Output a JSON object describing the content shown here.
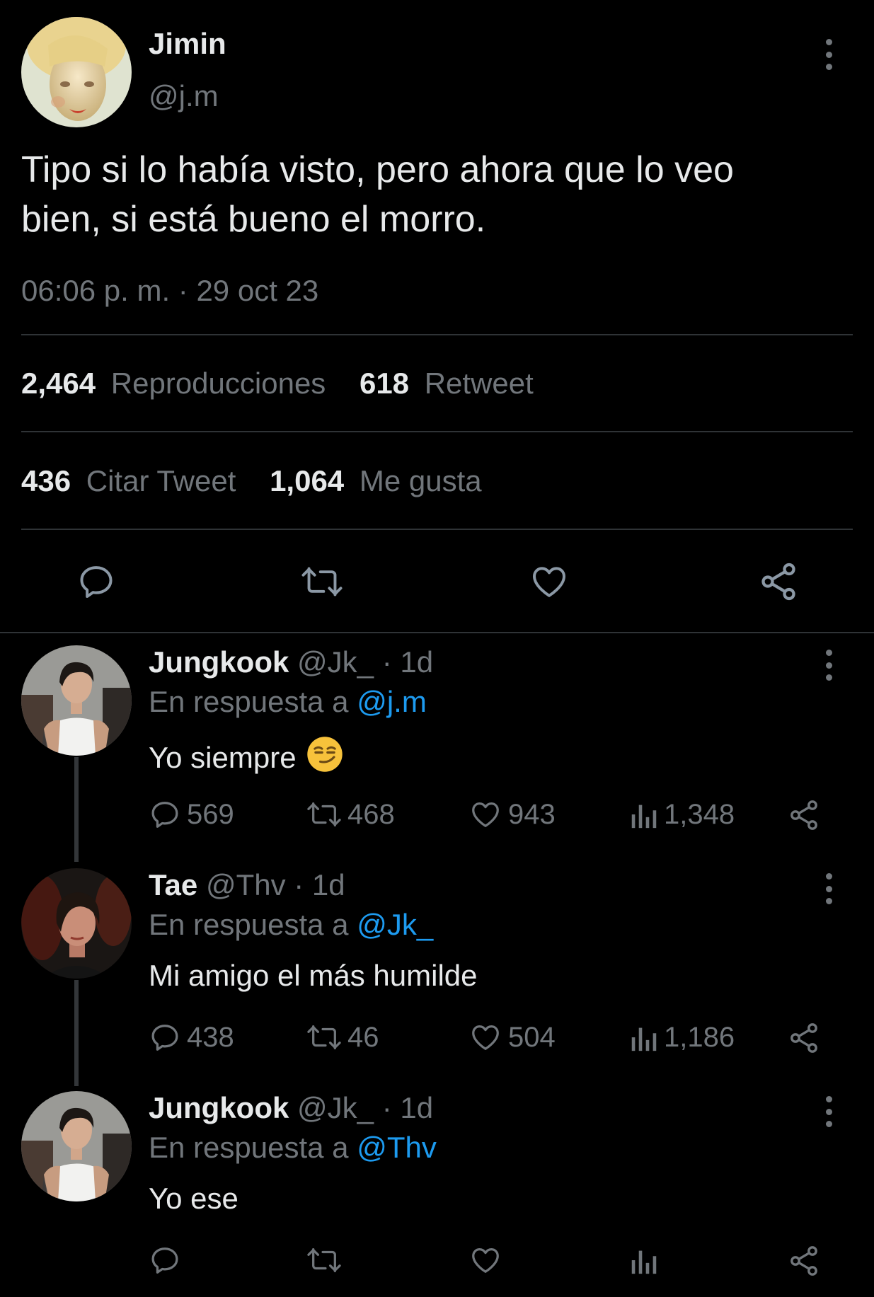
{
  "main_tweet": {
    "display_name": "Jimin",
    "handle": "@j.m",
    "text_line1": "Tipo si lo había visto, pero ahora que lo veo",
    "text_line2": "bien, si está bueno el morro.",
    "timestamp": "06:06 p. m. · 29 oct 23",
    "stats": {
      "views_count": "2,464",
      "views_label": "Reproducciones",
      "retweets_count": "618",
      "retweets_label": "Retweet",
      "quotes_count": "436",
      "quotes_label": "Citar Tweet",
      "likes_count": "1,064",
      "likes_label": "Me gusta"
    }
  },
  "replies": [
    {
      "display_name": "Jungkook",
      "handle": "@Jk_",
      "time": "· 1d",
      "reply_prefix": "En respuesta a",
      "reply_to": "@j.m",
      "text": "Yo siempre",
      "emoji": "smirking-face",
      "replies": "569",
      "retweets": "468",
      "likes": "943",
      "views": "1,348"
    },
    {
      "display_name": "Tae",
      "handle": "@Thv",
      "time": "· 1d",
      "reply_prefix": "En respuesta a",
      "reply_to": "@Jk_",
      "text": "Mi amigo el más humilde",
      "replies": "438",
      "retweets": "46",
      "likes": "504",
      "views": "1,186"
    },
    {
      "display_name": "Jungkook",
      "handle": "@Jk_",
      "time": "· 1d",
      "reply_prefix": "En respuesta a",
      "reply_to": "@Thv",
      "text": "Yo ese",
      "replies": "",
      "retweets": "",
      "likes": "",
      "views": ""
    }
  ],
  "colors": {
    "background": "#000000",
    "text": "#e7e9ea",
    "secondary": "#71767b",
    "link": "#1d9bf0",
    "divider": "#2f3336"
  }
}
